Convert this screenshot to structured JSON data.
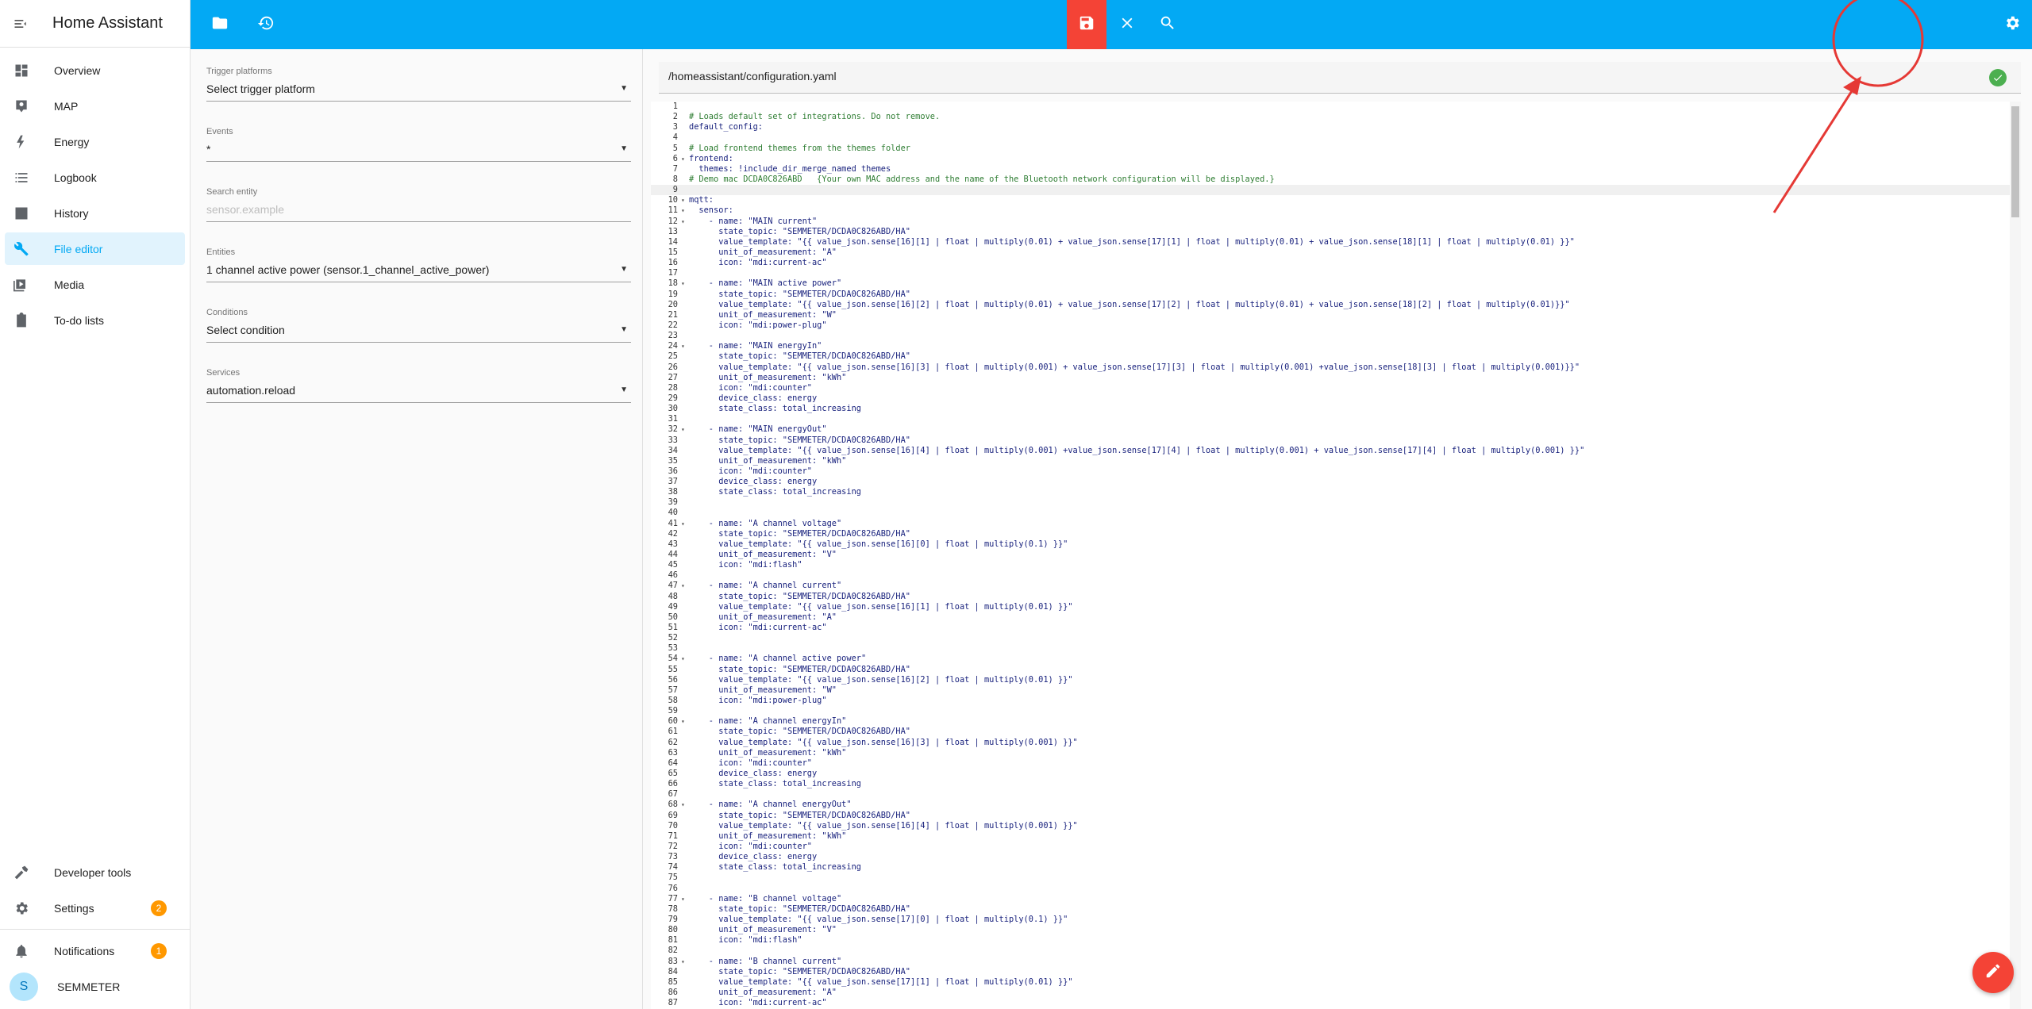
{
  "app": {
    "title": "Home Assistant"
  },
  "sidebar": {
    "items": [
      {
        "label": "Overview",
        "icon": "dashboard-icon"
      },
      {
        "label": "MAP",
        "icon": "map-icon"
      },
      {
        "label": "Energy",
        "icon": "lightning-icon"
      },
      {
        "label": "Logbook",
        "icon": "list-icon"
      },
      {
        "label": "History",
        "icon": "chart-icon"
      },
      {
        "label": "File editor",
        "icon": "wrench-icon"
      },
      {
        "label": "Media",
        "icon": "media-icon"
      },
      {
        "label": "To-do lists",
        "icon": "clipboard-icon"
      }
    ],
    "bottom": [
      {
        "label": "Developer tools",
        "icon": "hammer-icon"
      },
      {
        "label": "Settings",
        "icon": "gear-icon",
        "badge": "2"
      },
      {
        "label": "Notifications",
        "icon": "bell-icon",
        "badge": "1"
      },
      {
        "label": "SEMMETER",
        "icon": "avatar",
        "initial": "S"
      }
    ]
  },
  "topbar": {
    "accent": "#03a9f4",
    "save_accent": "#f44336"
  },
  "form": {
    "trigger": {
      "label": "Trigger platforms",
      "value": "Select trigger platform"
    },
    "events": {
      "label": "Events",
      "value": "*"
    },
    "search": {
      "label": "Search entity",
      "placeholder": "sensor.example"
    },
    "entities": {
      "label": "Entities",
      "value": "1 channel active power (sensor.1_channel_active_power)"
    },
    "conditions": {
      "label": "Conditions",
      "value": "Select condition"
    },
    "services": {
      "label": "Services",
      "value": "automation.reload"
    }
  },
  "editor": {
    "path": "/homeassistant/configuration.yaml",
    "lines": [
      "",
      "# Loads default set of integrations. Do not remove.",
      "default_config:",
      "",
      "# Load frontend themes from the themes folder",
      "frontend:",
      "  themes: !include_dir_merge_named themes",
      "# Demo mac DCDA0C826ABD   {Your own MAC address and the name of the Bluetooth network configuration will be displayed.}",
      "",
      "mqtt:",
      "  sensor:",
      "    - name: \"MAIN current\"",
      "      state_topic: \"SEMMETER/DCDA0C826ABD/HA\"",
      "      value_template: \"{{ value_json.sense[16][1] | float | multiply(0.01) + value_json.sense[17][1] | float | multiply(0.01) + value_json.sense[18][1] | float | multiply(0.01) }}\"",
      "      unit_of_measurement: \"A\"",
      "      icon: \"mdi:current-ac\"",
      "",
      "    - name: \"MAIN active power\"",
      "      state_topic: \"SEMMETER/DCDA0C826ABD/HA\"",
      "      value_template: \"{{ value_json.sense[16][2] | float | multiply(0.01) + value_json.sense[17][2] | float | multiply(0.01) + value_json.sense[18][2] | float | multiply(0.01)}}\"",
      "      unit_of_measurement: \"W\"",
      "      icon: \"mdi:power-plug\"",
      "",
      "    - name: \"MAIN energyIn\"",
      "      state_topic: \"SEMMETER/DCDA0C826ABD/HA\"",
      "      value_template: \"{{ value_json.sense[16][3] | float | multiply(0.001) + value_json.sense[17][3] | float | multiply(0.001) +value_json.sense[18][3] | float | multiply(0.001)}}\"",
      "      unit_of_measurement: \"kWh\"",
      "      icon: \"mdi:counter\"",
      "      device_class: energy",
      "      state_class: total_increasing",
      "",
      "    - name: \"MAIN energyOut\"",
      "      state_topic: \"SEMMETER/DCDA0C826ABD/HA\"",
      "      value_template: \"{{ value_json.sense[16][4] | float | multiply(0.001) +value_json.sense[17][4] | float | multiply(0.001) + value_json.sense[17][4] | float | multiply(0.001) }}\"",
      "      unit_of_measurement: \"kWh\"",
      "      icon: \"mdi:counter\"",
      "      device_class: energy",
      "      state_class: total_increasing",
      "",
      "",
      "    - name: \"A channel voltage\"",
      "      state_topic: \"SEMMETER/DCDA0C826ABD/HA\"",
      "      value_template: \"{{ value_json.sense[16][0] | float | multiply(0.1) }}\"",
      "      unit_of_measurement: \"V\"",
      "      icon: \"mdi:flash\"",
      "",
      "    - name: \"A channel current\"",
      "      state_topic: \"SEMMETER/DCDA0C826ABD/HA\"",
      "      value_template: \"{{ value_json.sense[16][1] | float | multiply(0.01) }}\"",
      "      unit_of_measurement: \"A\"",
      "      icon: \"mdi:current-ac\"",
      "",
      "",
      "    - name: \"A channel active power\"",
      "      state_topic: \"SEMMETER/DCDA0C826ABD/HA\"",
      "      value_template: \"{{ value_json.sense[16][2] | float | multiply(0.01) }}\"",
      "      unit_of_measurement: \"W\"",
      "      icon: \"mdi:power-plug\"",
      "",
      "    - name: \"A channel energyIn\"",
      "      state_topic: \"SEMMETER/DCDA0C826ABD/HA\"",
      "      value_template: \"{{ value_json.sense[16][3] | float | multiply(0.001) }}\"",
      "      unit_of_measurement: \"kWh\"",
      "      icon: \"mdi:counter\"",
      "      device_class: energy",
      "      state_class: total_increasing",
      "",
      "    - name: \"A channel energyOut\"",
      "      state_topic: \"SEMMETER/DCDA0C826ABD/HA\"",
      "      value_template: \"{{ value_json.sense[16][4] | float | multiply(0.001) }}\"",
      "      unit_of_measurement: \"kWh\"",
      "      icon: \"mdi:counter\"",
      "      device_class: energy",
      "      state_class: total_increasing",
      "",
      "",
      "    - name: \"B channel voltage\"",
      "      state_topic: \"SEMMETER/DCDA0C826ABD/HA\"",
      "      value_template: \"{{ value_json.sense[17][0] | float | multiply(0.1) }}\"",
      "      unit_of_measurement: \"V\"",
      "      icon: \"mdi:flash\"",
      "",
      "    - name: \"B channel current\"",
      "      state_topic: \"SEMMETER/DCDA0C826ABD/HA\"",
      "      value_template: \"{{ value_json.sense[17][1] | float | multiply(0.01) }}\"",
      "      unit_of_measurement: \"A\"",
      "      icon: \"mdi:current-ac\""
    ],
    "folds": [
      6,
      10,
      11,
      12,
      18,
      24,
      32,
      41,
      47,
      54,
      60,
      68,
      77,
      83
    ],
    "highlight_line": 9
  }
}
